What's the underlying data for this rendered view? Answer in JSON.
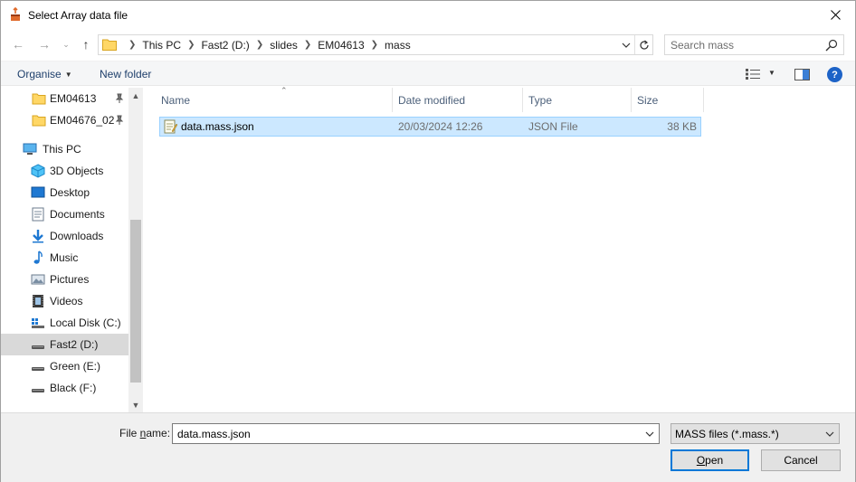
{
  "window": {
    "title": "Select Array data file"
  },
  "nav": {
    "breadcrumbs": [
      "This PC",
      "Fast2 (D:)",
      "slides",
      "EM04613",
      "mass"
    ],
    "search_placeholder": "Search mass"
  },
  "toolbar": {
    "organise_label": "Organise",
    "new_folder_label": "New folder"
  },
  "sidebar": {
    "items": [
      {
        "label": "EM04613",
        "icon": "folder-icon",
        "pinned": true
      },
      {
        "label": "EM04676_02",
        "icon": "folder-icon",
        "pinned": true
      },
      {
        "label": "This PC",
        "icon": "computer-icon"
      },
      {
        "label": "3D Objects",
        "icon": "cube-icon"
      },
      {
        "label": "Desktop",
        "icon": "desktop-icon"
      },
      {
        "label": "Documents",
        "icon": "documents-icon"
      },
      {
        "label": "Downloads",
        "icon": "download-icon"
      },
      {
        "label": "Music",
        "icon": "music-icon"
      },
      {
        "label": "Pictures",
        "icon": "pictures-icon"
      },
      {
        "label": "Videos",
        "icon": "videos-icon"
      },
      {
        "label": "Local Disk (C:)",
        "icon": "drive-icon"
      },
      {
        "label": "Fast2 (D:)",
        "icon": "drive-icon",
        "selected": true
      },
      {
        "label": "Green (E:)",
        "icon": "drive-icon"
      },
      {
        "label": "Black (F:)",
        "icon": "drive-icon"
      }
    ]
  },
  "filelist": {
    "columns": [
      "Name",
      "Date modified",
      "Type",
      "Size"
    ],
    "rows": [
      {
        "name": "data.mass.json",
        "date": "20/03/2024 12:26",
        "type": "JSON File",
        "size": "38 KB",
        "selected": true
      }
    ]
  },
  "footer": {
    "file_name_label_pre": "File ",
    "file_name_label_u": "n",
    "file_name_label_post": "ame:",
    "file_name_value": "data.mass.json",
    "filter_value": "MASS files (*.mass.*)",
    "open_u": "O",
    "open_rest": "pen",
    "cancel_label": "Cancel"
  },
  "colors": {
    "selection_bg": "#cce8ff",
    "selection_border": "#99d1ff",
    "accent": "#0078d7",
    "sidebar_selected": "#d9d9d9"
  }
}
